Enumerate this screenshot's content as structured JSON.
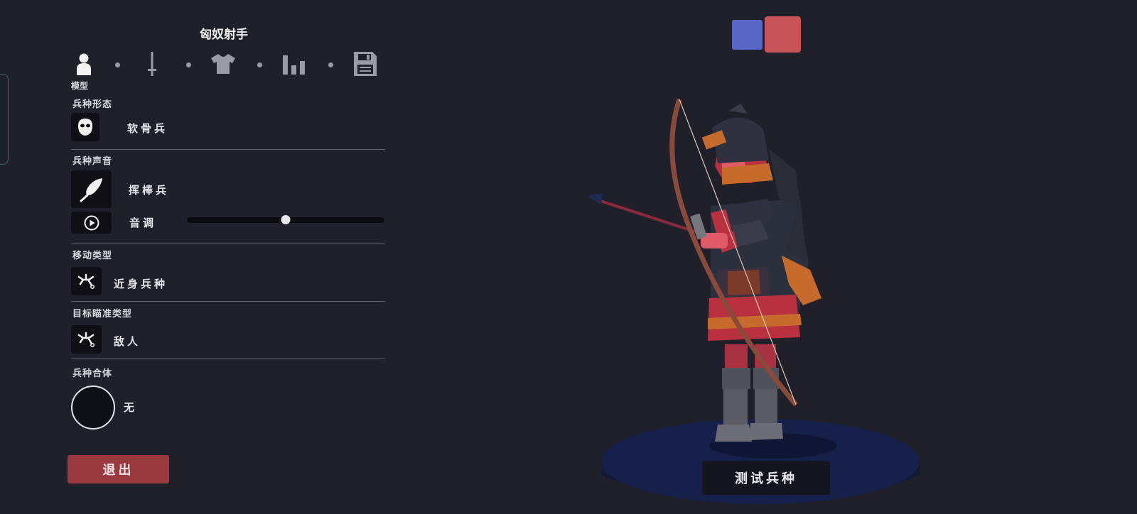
{
  "panel": {
    "title": "匈奴射手"
  },
  "tabs": [
    {
      "icon": "person-icon",
      "caption": "模型",
      "active": true
    },
    {
      "icon": "sword-icon"
    },
    {
      "icon": "shirt-icon"
    },
    {
      "icon": "stats-icon"
    },
    {
      "icon": "save-icon"
    }
  ],
  "sections": {
    "form": {
      "label": "兵种形态",
      "value": "软骨兵",
      "icon": "mask-icon"
    },
    "sound": {
      "label": "兵种声音",
      "value": "挥棒兵",
      "icon": "feather-icon",
      "pitch_label": "音调",
      "pitch_level": 0.5
    },
    "move": {
      "label": "移动类型",
      "value": "近身兵种",
      "icon": "running-figure-icon"
    },
    "target": {
      "label": "目标瞄准类型",
      "value": "敌人",
      "icon": "aim-figure-icon"
    },
    "combine": {
      "label": "兵种合体",
      "value": "无"
    }
  },
  "buttons": {
    "exit": "退出",
    "test": "测试兵种"
  },
  "team_colors": {
    "blue": "#5867c4",
    "red": "#c8545a"
  }
}
